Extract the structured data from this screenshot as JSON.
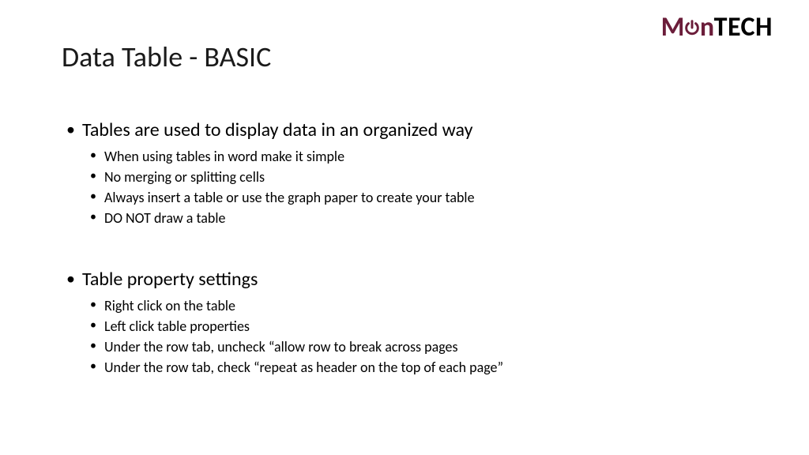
{
  "logo": {
    "part1": "M",
    "part2": "n",
    "part3": "TECH"
  },
  "title": "Data Table - BASIC",
  "sections": [
    {
      "heading": "Tables are used to display data in an organized way",
      "items": [
        "When using tables in word make it simple",
        "No merging or splitting cells",
        "Always insert a table or use the graph paper to create your table",
        "DO NOT draw a table"
      ]
    },
    {
      "heading": "Table property settings",
      "items": [
        "Right click on the table",
        "Left click table properties",
        "Under the row tab, uncheck “allow row to break across pages",
        "Under the row tab, check “repeat as header on the top of each page”"
      ]
    }
  ]
}
